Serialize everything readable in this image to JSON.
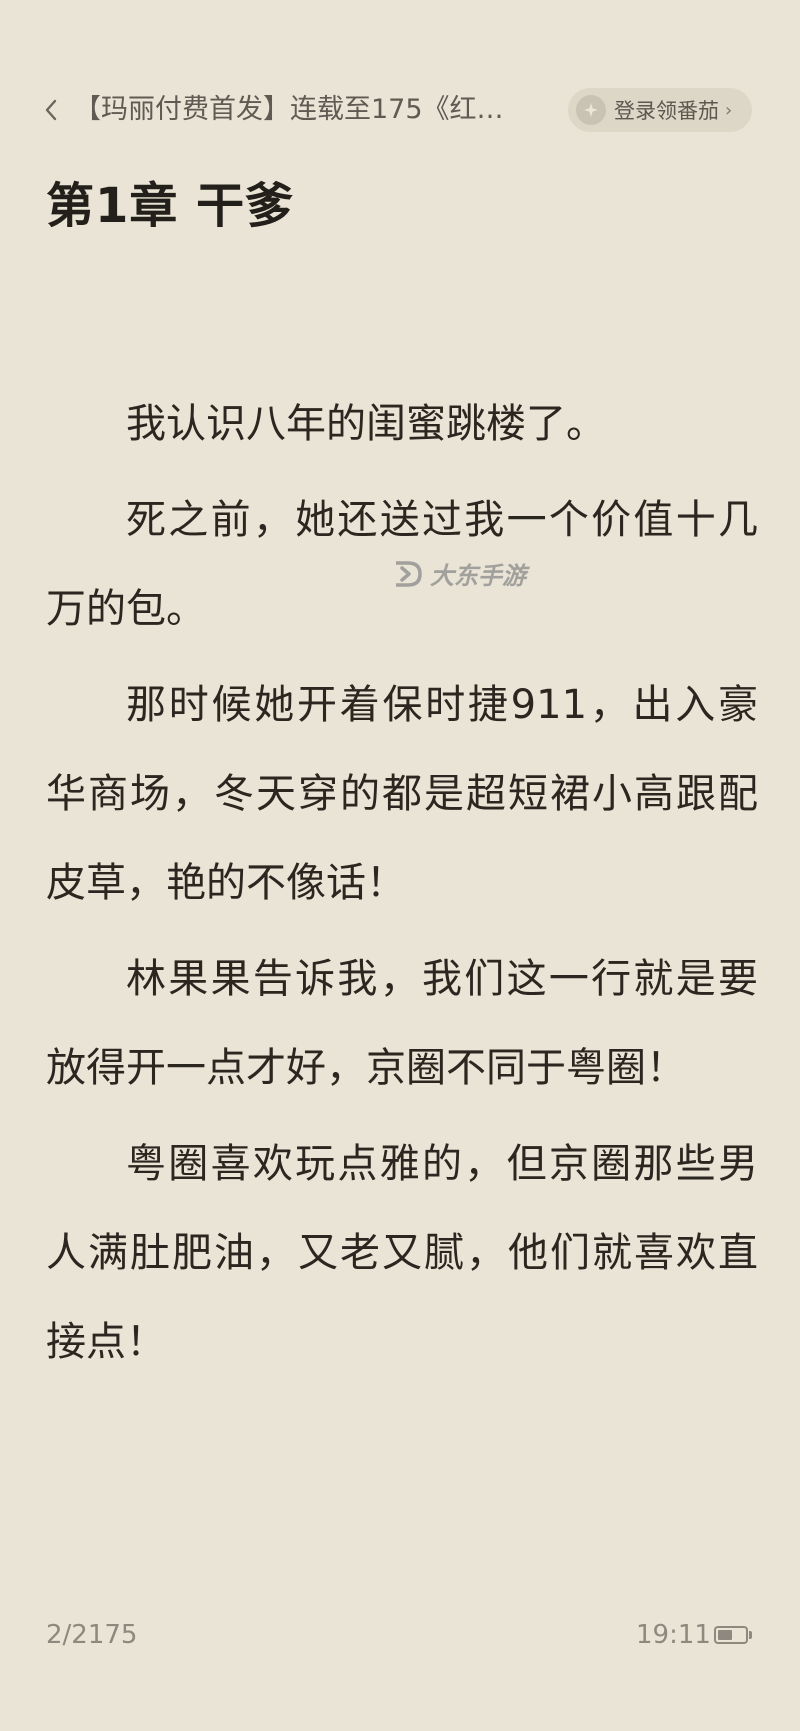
{
  "header": {
    "back_icon": "chevron-left-icon",
    "book_title": "【玛丽付费首发】连载至175《红尘...",
    "login_button": {
      "icon": "sparkle-icon",
      "label": "登录领番茄",
      "chevron": "›"
    }
  },
  "chapter": {
    "title": "第1章  干爹"
  },
  "paragraphs": [
    "我认识八年的闺蜜跳楼了。",
    "死之前，她还送过我一个价值十几万的包。",
    "那时候她开着保时捷911，出入豪华商场，冬天穿的都是超短裙小高跟配皮草，艳的不像话！",
    "林果果告诉我，我们这一行就是要放得开一点才好，京圈不同于粤圈！",
    "粤圈喜欢玩点雅的，但京圈那些男人满肚肥油，又老又腻，他们就喜欢直接点！"
  ],
  "watermark": {
    "icon": "dadong-logo-icon",
    "text": "大东手游"
  },
  "footer": {
    "page_indicator": "2/2175",
    "time": "19:11",
    "battery_icon": "battery-icon",
    "battery_level": 0.55
  }
}
